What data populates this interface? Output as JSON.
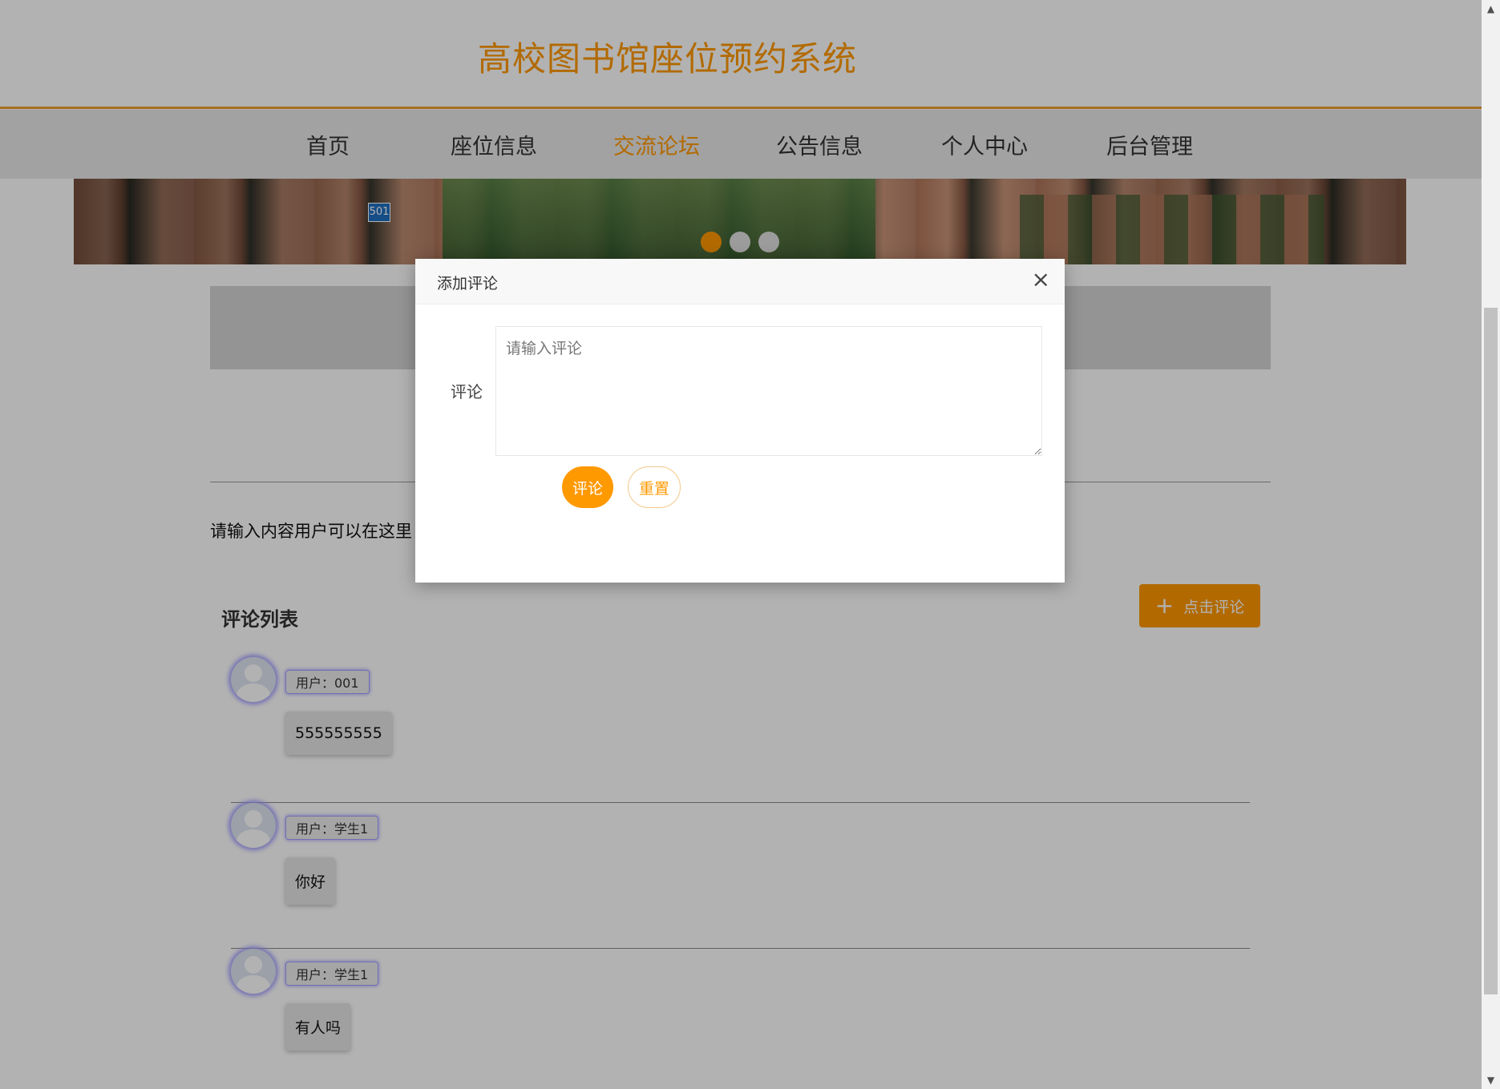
{
  "site": {
    "title": "高校图书馆座位预约系统"
  },
  "nav": {
    "items": [
      {
        "label": "首页"
      },
      {
        "label": "座位信息"
      },
      {
        "label": "交流论坛",
        "active": true
      },
      {
        "label": "公告信息"
      },
      {
        "label": "个人中心"
      },
      {
        "label": "后台管理"
      }
    ]
  },
  "banner": {
    "sign_text": "501",
    "slide_count": 3,
    "active_slide": 1
  },
  "main": {
    "content_text": "请输入内容用户可以在这里",
    "comments_title": "评论列表",
    "add_comment_label": "点击评论"
  },
  "comments": [
    {
      "user": "用户：001",
      "text": "555555555"
    },
    {
      "user": "用户：学生1",
      "text": "你好"
    },
    {
      "user": "用户：学生1",
      "text": "有人吗"
    }
  ],
  "modal": {
    "title": "添加评论",
    "close_icon": "×",
    "field_label": "评论",
    "placeholder": "请输入评论",
    "submit_label": "评论",
    "reset_label": "重置"
  },
  "colors": {
    "accent": "#ff9900",
    "nav_bg": "#e8e8e8",
    "overlay": "rgba(0,0,0,0.3)"
  }
}
